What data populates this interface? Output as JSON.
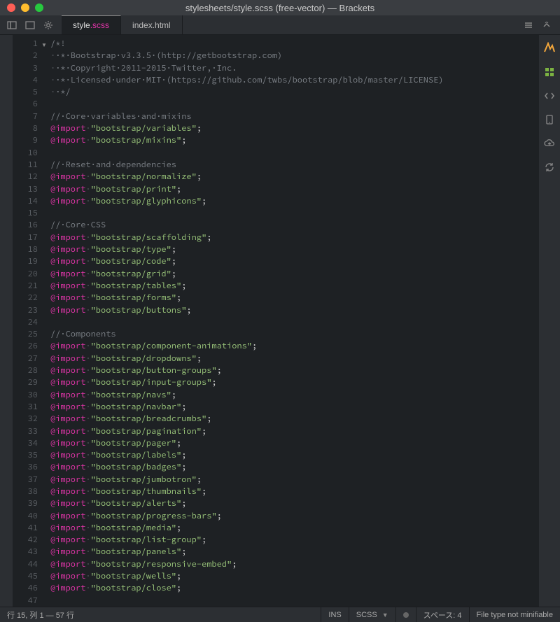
{
  "window": {
    "title": "stylesheets/style.scss (free-vector) — Brackets"
  },
  "tabs": [
    {
      "base": "style",
      "ext": ".scss",
      "active": true
    },
    {
      "base": "index.html",
      "ext": "",
      "active": false
    }
  ],
  "code": {
    "lines": [
      {
        "type": "comment",
        "text": "/*!"
      },
      {
        "type": "comment-ws",
        "text": " * Bootstrap v3.3.5 (http://getbootstrap.com)"
      },
      {
        "type": "comment-ws",
        "text": " * Copyright 2011-2015 Twitter, Inc."
      },
      {
        "type": "comment-ws",
        "text": " * Licensed under MIT (https://github.com/twbs/bootstrap/blob/master/LICENSE)"
      },
      {
        "type": "comment-ws",
        "text": " */"
      },
      {
        "type": "blank",
        "text": ""
      },
      {
        "type": "comment-ln",
        "text": "// Core variables and mixins"
      },
      {
        "type": "import",
        "path": "bootstrap/variables"
      },
      {
        "type": "import",
        "path": "bootstrap/mixins"
      },
      {
        "type": "blank",
        "text": ""
      },
      {
        "type": "comment-ln",
        "text": "// Reset and dependencies"
      },
      {
        "type": "import",
        "path": "bootstrap/normalize"
      },
      {
        "type": "import",
        "path": "bootstrap/print"
      },
      {
        "type": "import",
        "path": "bootstrap/glyphicons"
      },
      {
        "type": "blank",
        "text": ""
      },
      {
        "type": "comment-ln",
        "text": "// Core CSS"
      },
      {
        "type": "import",
        "path": "bootstrap/scaffolding"
      },
      {
        "type": "import",
        "path": "bootstrap/type"
      },
      {
        "type": "import",
        "path": "bootstrap/code"
      },
      {
        "type": "import",
        "path": "bootstrap/grid"
      },
      {
        "type": "import",
        "path": "bootstrap/tables"
      },
      {
        "type": "import",
        "path": "bootstrap/forms"
      },
      {
        "type": "import",
        "path": "bootstrap/buttons"
      },
      {
        "type": "blank",
        "text": ""
      },
      {
        "type": "comment-ln",
        "text": "// Components"
      },
      {
        "type": "import",
        "path": "bootstrap/component-animations"
      },
      {
        "type": "import",
        "path": "bootstrap/dropdowns"
      },
      {
        "type": "import",
        "path": "bootstrap/button-groups"
      },
      {
        "type": "import",
        "path": "bootstrap/input-groups"
      },
      {
        "type": "import",
        "path": "bootstrap/navs"
      },
      {
        "type": "import",
        "path": "bootstrap/navbar"
      },
      {
        "type": "import",
        "path": "bootstrap/breadcrumbs"
      },
      {
        "type": "import",
        "path": "bootstrap/pagination"
      },
      {
        "type": "import",
        "path": "bootstrap/pager"
      },
      {
        "type": "import",
        "path": "bootstrap/labels"
      },
      {
        "type": "import",
        "path": "bootstrap/badges"
      },
      {
        "type": "import",
        "path": "bootstrap/jumbotron"
      },
      {
        "type": "import",
        "path": "bootstrap/thumbnails"
      },
      {
        "type": "import",
        "path": "bootstrap/alerts"
      },
      {
        "type": "import",
        "path": "bootstrap/progress-bars"
      },
      {
        "type": "import",
        "path": "bootstrap/media"
      },
      {
        "type": "import",
        "path": "bootstrap/list-group"
      },
      {
        "type": "import",
        "path": "bootstrap/panels"
      },
      {
        "type": "import",
        "path": "bootstrap/responsive-embed"
      },
      {
        "type": "import",
        "path": "bootstrap/wells"
      },
      {
        "type": "import",
        "path": "bootstrap/close"
      },
      {
        "type": "blank",
        "text": ""
      }
    ]
  },
  "status": {
    "cursor": "行 15, 列 1 — 57 行",
    "ins": "INS",
    "lang": "SCSS",
    "spaces": "スペース: 4",
    "minify": "File type not minifiable"
  }
}
